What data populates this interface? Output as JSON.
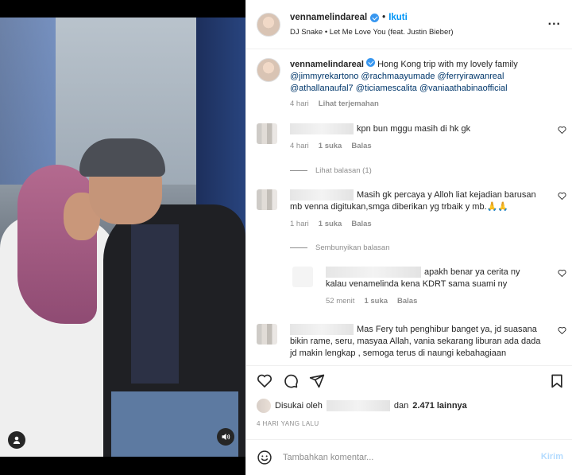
{
  "header": {
    "username": "vennamelindareal",
    "separator": "•",
    "follow_label": "Ikuti",
    "song": "DJ Snake • Let Me Love You (feat. Justin Bieber)",
    "more_label": "..."
  },
  "caption": {
    "username": "vennamelindareal",
    "text": "Hong Kong trip with my lovely family",
    "mentions": "@jimmyrekartono @rachmaayumade @ferryirawanreal @athallanaufal7 @ticiamescalita @vaniaathabinaofficial",
    "time": "4 hari",
    "translate_label": "Lihat terjemahan"
  },
  "comments": [
    {
      "text": "kpn bun mggu masih di hk gk",
      "time": "4 hari",
      "likes": "1 suka",
      "reply_label": "Balas"
    },
    {
      "text": "Masih gk percaya y Alloh liat kejadian barusan mb venna digitukan,smga diberikan yg trbaik y mb.🙏🙏",
      "time": "1 hari",
      "likes": "1 suka",
      "reply_label": "Balas"
    },
    {
      "text": "apakh benar ya cerita ny kalau venamelinda kena KDRT sama suami ny",
      "time": "52 menit",
      "likes": "1 suka",
      "reply_label": "Balas"
    },
    {
      "text": "Mas Fery tuh penghibur banget ya, jd suasana bikin rame, seru, masyaa Allah, vania sekarang liburan ada dada jd makin lengkap , semoga terus di naungi kebahagiaan"
    }
  ],
  "view_replies_label": "Lihat balasan (1)",
  "hide_replies_label": "Sembunyikan balasan",
  "likes": {
    "prefix": "Disukai oleh",
    "connector": "dan",
    "others": "2.471 lainnya"
  },
  "timestamp": "4 HARI YANG LALU",
  "add_comment": {
    "placeholder": "Tambahkan komentar...",
    "send_label": "Kirim"
  },
  "colors": {
    "link": "#00376b",
    "accent": "#0095f6",
    "muted": "#8e8e8e",
    "send_disabled": "#b3dbff"
  }
}
